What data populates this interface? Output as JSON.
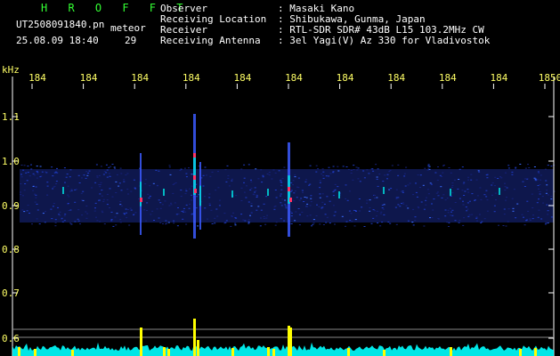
{
  "header": {
    "logo": "H R O F F T",
    "filename": "UT2508091840.pn",
    "mode_label": "meteor",
    "datetime": "25.08.09 18:40",
    "count": "29",
    "fields": [
      {
        "label": "Observer",
        "value": ": Masaki Kano"
      },
      {
        "label": "Receiving Location",
        "value": ": Shibukawa, Gunma, Japan"
      },
      {
        "label": "Receiver",
        "value": ": RTL-SDR SDR# 43dB L15 103.2MHz CW"
      },
      {
        "label": "Receiving Antenna",
        "value": ": 3el Yagi(V) Az 330 for Vladivostok"
      }
    ]
  },
  "plot": {
    "y_unit": "kHz",
    "x_tick_labels": [
      "184",
      "184",
      "184",
      "184",
      "184",
      "184",
      "184",
      "184",
      "184",
      "184",
      "1850"
    ],
    "y_tick_labels": [
      "1.1",
      "1.0",
      "0.9",
      "0.8",
      "0.7",
      "0.6"
    ],
    "colors": {
      "band": "#1a2a8a",
      "axis": "#ffffff",
      "bars": "#ffff00",
      "noise": "#00ffff",
      "tick_text": "#ffff66"
    }
  }
}
